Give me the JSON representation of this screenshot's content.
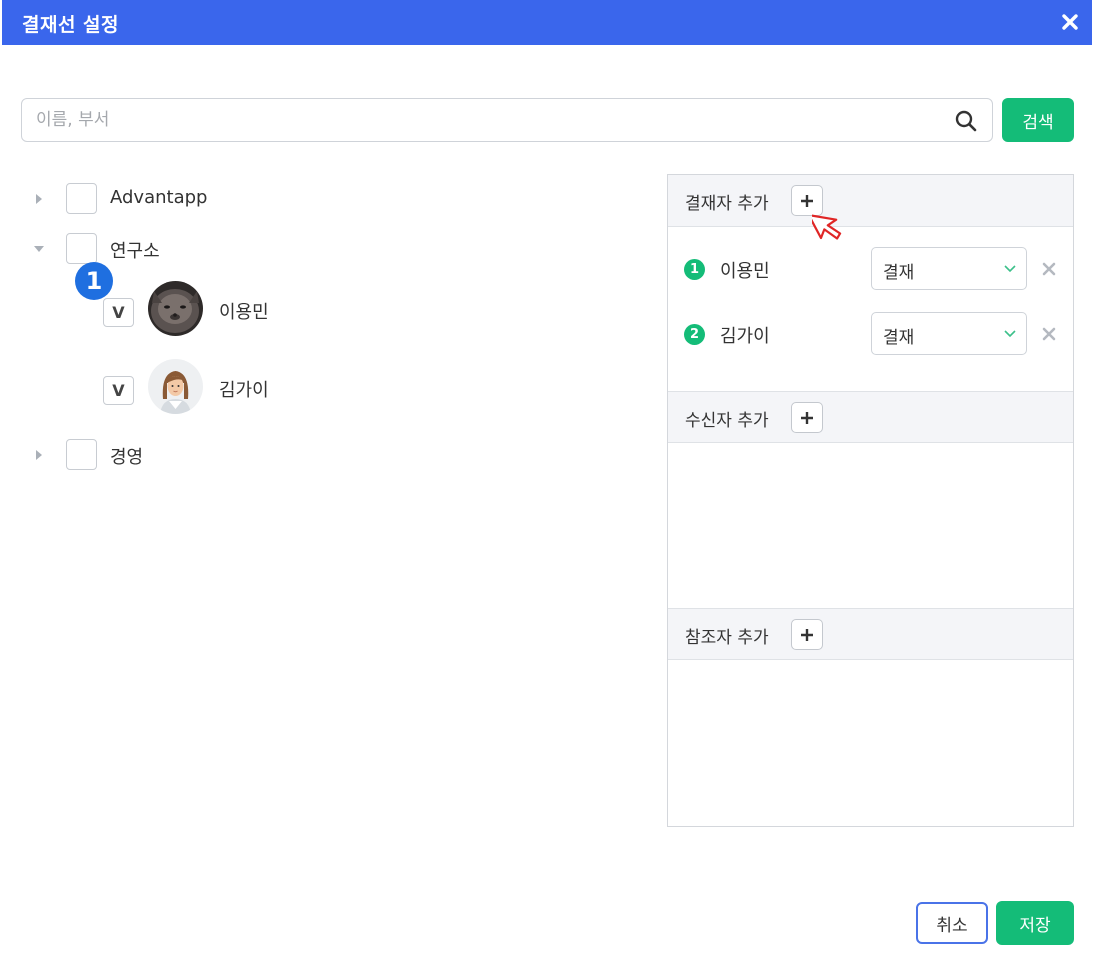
{
  "dialog": {
    "title": "결재선 설정",
    "close_icon": "close-icon"
  },
  "search": {
    "placeholder": "이름, 부서",
    "value": "",
    "button_label": "검색"
  },
  "tree": {
    "nodes": [
      {
        "label": "Advantapp",
        "expanded": false,
        "checked": false
      },
      {
        "label": "연구소",
        "expanded": true,
        "checked": false,
        "members": [
          {
            "name": "이용민",
            "check_mark": "V"
          },
          {
            "name": "김가이",
            "check_mark": "V"
          }
        ]
      },
      {
        "label": "경영",
        "expanded": false,
        "checked": false
      }
    ],
    "step_badge": "1"
  },
  "panel": {
    "approvers": {
      "title": "결재자 추가",
      "items": [
        {
          "order": "1",
          "name": "이용민",
          "type": "결재"
        },
        {
          "order": "2",
          "name": "김가이",
          "type": "결재"
        }
      ]
    },
    "receivers": {
      "title": "수신자 추가"
    },
    "references": {
      "title": "참조자 추가"
    }
  },
  "footer": {
    "cancel_label": "취소",
    "save_label": "저장"
  },
  "colors": {
    "titlebar": "#3a66ec",
    "accent_green": "#14bc78",
    "badge_blue": "#1f6fe0"
  }
}
